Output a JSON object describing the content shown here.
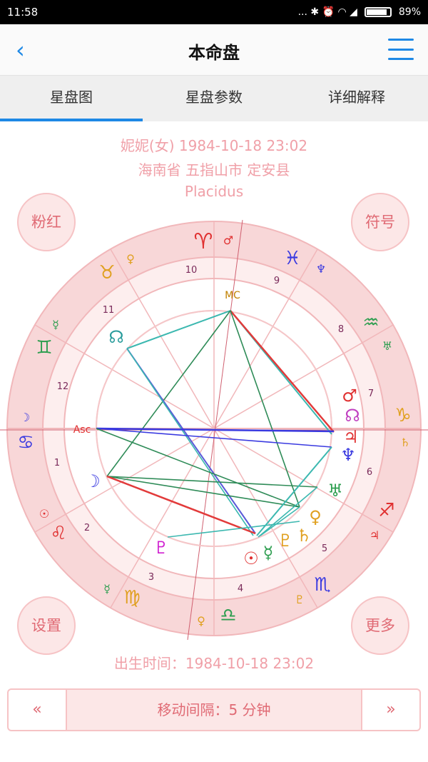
{
  "status": {
    "time": "11:58",
    "icons": "... ✱ ⏰ ◠ ◢",
    "battery": "89%",
    "battery_level": 0.89
  },
  "header": {
    "title": "本命盘",
    "back_icon": "‹"
  },
  "tabs": [
    {
      "label": "星盘图"
    },
    {
      "label": "星盘参数"
    },
    {
      "label": "详细解释"
    }
  ],
  "info": {
    "line1": "妮妮(女) 1984-10-18 23:02",
    "line2": "海南省 五指山市 定安县",
    "line3": "Placidus"
  },
  "buttons": {
    "pink": "粉红",
    "symbol": "符号",
    "settings": "设置",
    "more": "更多"
  },
  "birth_time": "出生时间：1984-10-18 23:02",
  "stepper": {
    "prev": "«",
    "next": "»",
    "label": "移动间隔：5 分钟"
  },
  "chart": {
    "signs": [
      "♈",
      "♉",
      "♊",
      "♋",
      "♌",
      "♍",
      "♎",
      "♏",
      "♐",
      "♑",
      "♒",
      "♓"
    ],
    "houses": [
      "1",
      "2",
      "3",
      "4",
      "5",
      "6",
      "7",
      "8",
      "9",
      "10",
      "11",
      "12"
    ],
    "angles": {
      "mc": "MC",
      "asc": "Asc"
    },
    "planets": [
      "☽",
      "☉",
      "☿",
      "♀",
      "♂",
      "♃",
      "♄",
      "♅",
      "♆",
      "♇",
      "☊"
    ]
  }
}
